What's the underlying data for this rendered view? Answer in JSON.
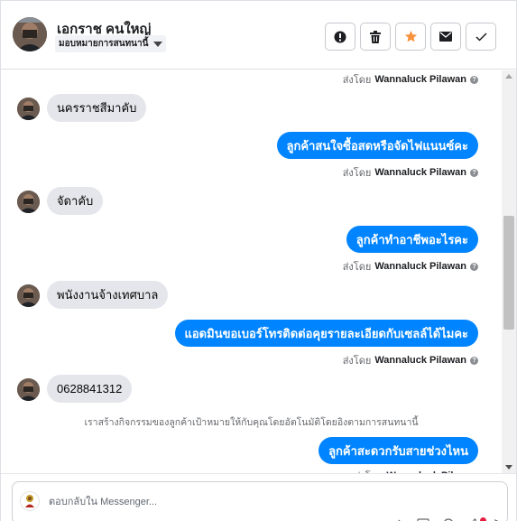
{
  "header": {
    "contact_name": "เอกราช คนใหญ่",
    "assign_label": "มอบหมายการสนทนานี้",
    "actions": [
      {
        "name": "report-button",
        "icon": "exclamation-icon",
        "color": "#1c1e21"
      },
      {
        "name": "delete-button",
        "icon": "trash-icon",
        "color": "#1c1e21"
      },
      {
        "name": "star-button",
        "icon": "star-icon",
        "color": "#f7923b"
      },
      {
        "name": "mail-button",
        "icon": "envelope-icon",
        "color": "#1c1e21"
      },
      {
        "name": "done-button",
        "icon": "checkmark-icon",
        "color": "#1c1e21"
      }
    ]
  },
  "conversation": {
    "sent_by_prefix": "ส่งโดย",
    "sender_name": "Wannaluck Pilawan",
    "messages": [
      {
        "dir": "in",
        "text": "นครราชสีมาคับ"
      },
      {
        "dir": "out",
        "text": "ลูกค้าสนใจซื้อสดหรือจัดไฟแนนซ์คะ"
      },
      {
        "dir": "in",
        "text": "จัดาคับ"
      },
      {
        "dir": "out",
        "text": "ลูกค้าทำอาชีพอะไรคะ"
      },
      {
        "dir": "in",
        "text": "พนังงานจ้างเทศบาล"
      },
      {
        "dir": "out",
        "text": "แอดมินขอเบอร์โทรติดต่อคุยรายละเอียดกับเซลล์ได้ไมคะ"
      },
      {
        "dir": "in",
        "text": "0628841312"
      },
      {
        "dir": "out",
        "text": "ลูกค้าสะดวกรับสายช่วงไหน"
      }
    ],
    "system_note": "เราสร้างกิจกรรมของลูกค้าเป้าหมายให้กับคุณโดยอัตโนมัติโดยอิงตามการสนทนานี้"
  },
  "reply": {
    "placeholder": "ตอบกลับใน Messenger..."
  },
  "colors": {
    "accent": "#0084ff",
    "incoming_bubble": "#e4e6eb",
    "star": "#f7923b",
    "notification": "#e41e3f"
  }
}
